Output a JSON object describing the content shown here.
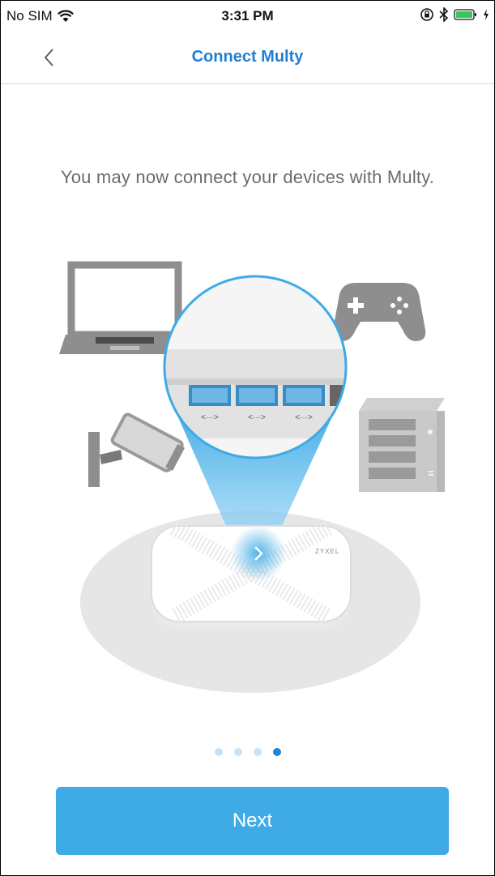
{
  "status_bar": {
    "carrier": "No SIM",
    "time": "3:31 PM",
    "icons": [
      "wifi-icon",
      "orientation-lock-icon",
      "bluetooth-icon",
      "battery-icon",
      "charging-icon"
    ]
  },
  "nav": {
    "back_icon": "chevron-left-icon",
    "title": "Connect Multy"
  },
  "main": {
    "message": "You may now connect your devices with Multy."
  },
  "illustration": {
    "devices": [
      "laptop-icon",
      "gamepad-icon",
      "security-camera-icon",
      "nas-server-icon",
      "router-icon"
    ],
    "router_brand": "ZYXEL",
    "port_label": "<···>",
    "accent_color": "#3eaae6"
  },
  "pagination": {
    "total": 4,
    "current": 4
  },
  "footer": {
    "next_label": "Next"
  }
}
